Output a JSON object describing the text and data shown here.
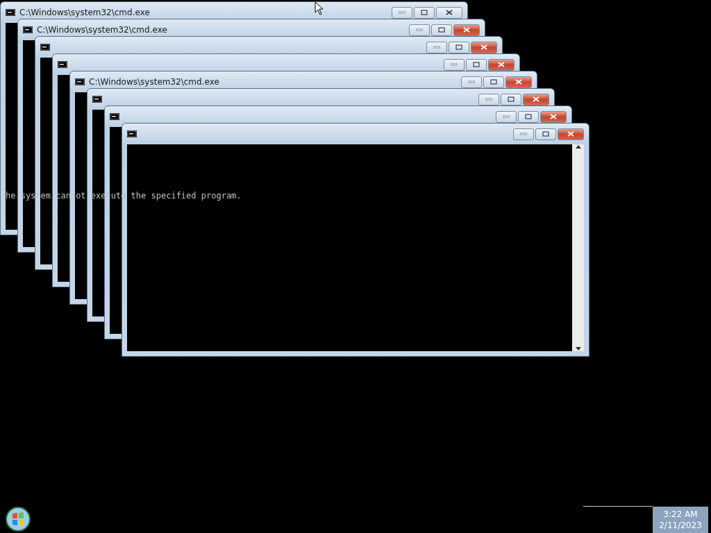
{
  "windows": [
    {
      "title": "C:\\Windows\\system32\\cmd.exe",
      "active": false
    },
    {
      "title": "C:\\Windows\\system32\\cmd.exe",
      "active": true
    },
    {
      "active": true
    },
    {
      "active": true
    },
    {
      "title": "C:\\Windows\\system32\\cmd.exe",
      "active": true
    },
    {
      "active": true
    },
    {
      "active": true
    },
    {
      "active": true
    }
  ],
  "console_text": "he system cannot execute the specified program.",
  "taskbar": {
    "time": "3:22 AM",
    "date": "2/11/2023"
  }
}
